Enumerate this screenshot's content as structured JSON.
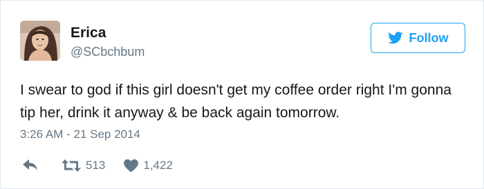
{
  "user": {
    "name": "Erica",
    "handle": "@SCbchbum"
  },
  "follow_button": {
    "label": "Follow"
  },
  "tweet": {
    "text": "I swear to god if this girl doesn't get my coffee order right I'm gonna tip her, drink it anyway & be back again tomorrow.",
    "timestamp": "3:26 AM - 21 Sep 2014"
  },
  "actions": {
    "retweets": "513",
    "likes": "1,422"
  },
  "colors": {
    "accent": "#1da1f2",
    "muted": "#657786",
    "text": "#14171a",
    "border": "#e1e8ed"
  },
  "icons": {
    "follow": "twitter-bird-icon",
    "reply": "reply-icon",
    "retweet": "retweet-icon",
    "like": "heart-icon"
  }
}
